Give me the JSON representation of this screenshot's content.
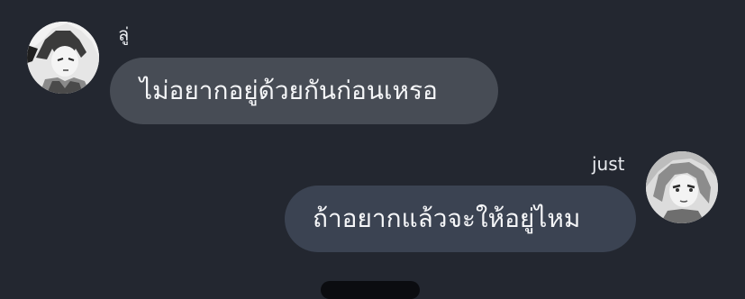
{
  "messages": [
    {
      "sender": "ลู่",
      "text": "ไม่อยากอยู่ด้วยกันก่อนเหรอ",
      "side": "left"
    },
    {
      "sender": "just",
      "text": "ถ้าอยากแล้วจะให้อยู่ไหม",
      "side": "right"
    }
  ],
  "colors": {
    "background": "#232730",
    "incoming_bubble": "#474c55",
    "outgoing_bubble": "#3b4352",
    "text": "#f5f6f8"
  }
}
